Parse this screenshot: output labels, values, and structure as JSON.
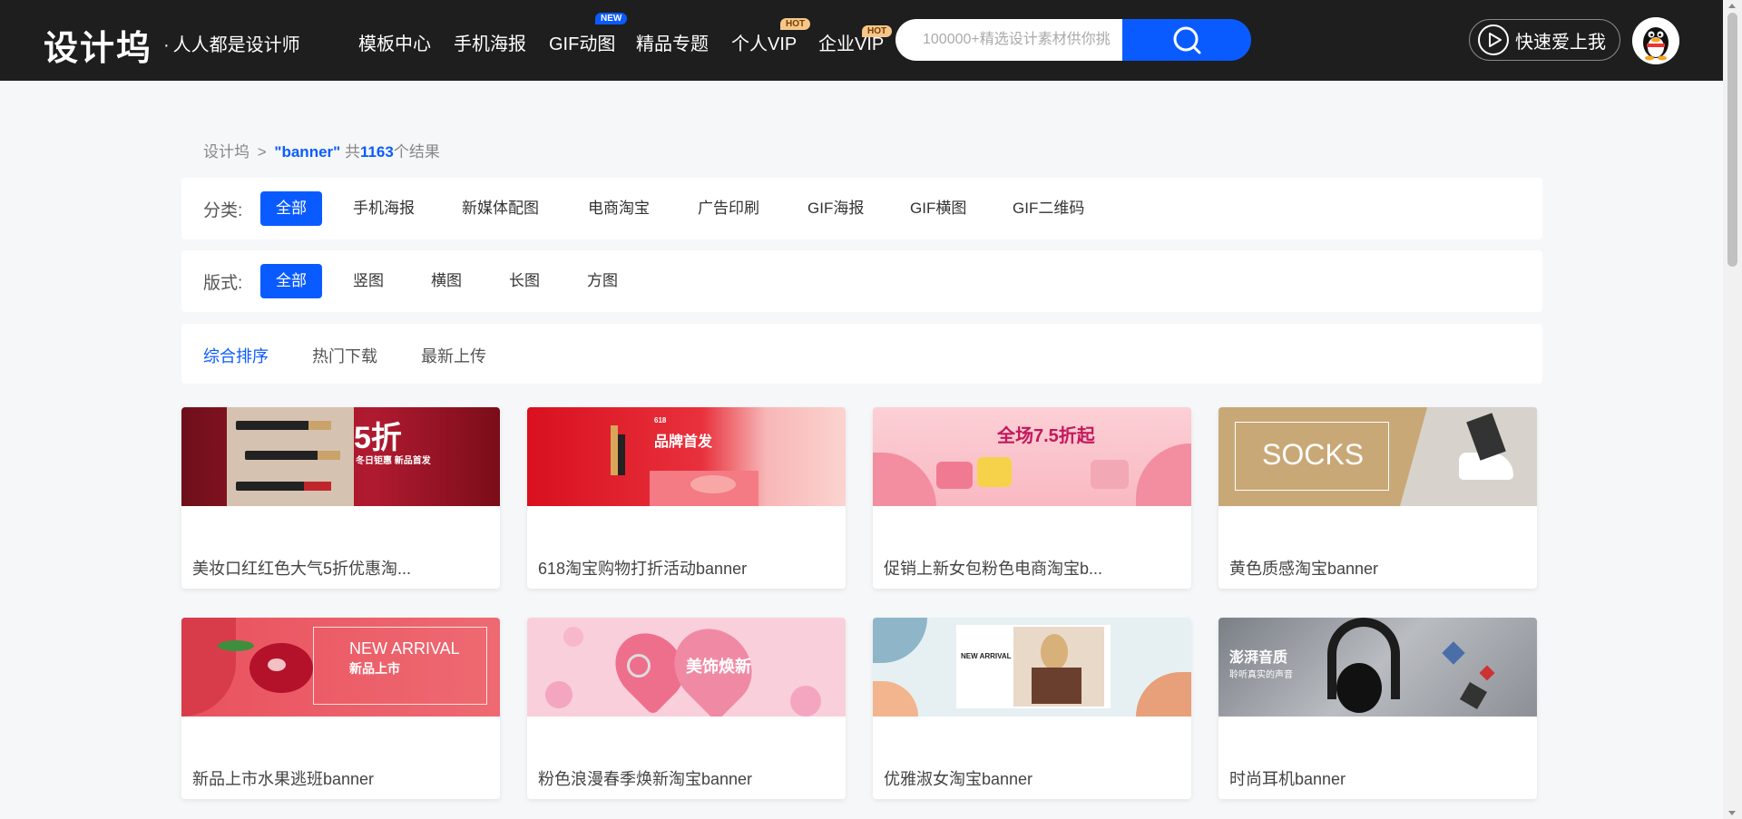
{
  "header": {
    "logo": "设计坞",
    "slogan": "人人都是设计师",
    "nav": [
      {
        "label": "模板中心",
        "badge": ""
      },
      {
        "label": "手机海报",
        "badge": ""
      },
      {
        "label": "GIF动图",
        "badge": "NEW"
      },
      {
        "label": "精品专题",
        "badge": ""
      },
      {
        "label": "个人VIP",
        "badge": "HOT"
      },
      {
        "label": "企业VIP",
        "badge": "HOT"
      }
    ],
    "search_placeholder": "100000+精选设计素材供你挑",
    "quick_label": "快速爱上我"
  },
  "breadcrumb": {
    "home": "设计坞",
    "separator": ">",
    "keyword": "\"banner\"",
    "prefix": "共",
    "count": "1163",
    "suffix": "个结果"
  },
  "filters": {
    "category_label": "分类:",
    "categories": [
      "全部",
      "手机海报",
      "新媒体配图",
      "电商淘宝",
      "广告印刷",
      "GIF海报",
      "GIF横图",
      "GIF二维码"
    ],
    "layout_label": "版式:",
    "layouts": [
      "全部",
      "竖图",
      "横图",
      "长图",
      "方图"
    ]
  },
  "sort": [
    "综合排序",
    "热门下载",
    "最新上传"
  ],
  "cards": [
    {
      "title": "美妆口红红色大气5折优惠淘...",
      "thumb_text": "5折",
      "thumb_sub": "冬日钜惠 新品首发"
    },
    {
      "title": "618淘宝购物打折活动banner",
      "thumb_text": "品牌首发",
      "thumb_sub": "618"
    },
    {
      "title": "促销上新女包粉色电商淘宝b...",
      "thumb_text": "全场7.5折起",
      "thumb_sub": ""
    },
    {
      "title": "黄色质感淘宝banner",
      "thumb_text": "SOCKS",
      "thumb_sub": ""
    },
    {
      "title": "新品上市水果逃班banner",
      "thumb_text": "NEW ARRIVAL",
      "thumb_sub": "新品上市"
    },
    {
      "title": "粉色浪漫春季焕新淘宝banner",
      "thumb_text": "美饰焕新",
      "thumb_sub": ""
    },
    {
      "title": "优雅淑女淘宝banner",
      "thumb_text": "NEW ARRIVAL",
      "thumb_sub": ""
    },
    {
      "title": "时尚耳机banner",
      "thumb_text": "澎湃音质",
      "thumb_sub": "聆听真实的声音"
    }
  ],
  "colors": {
    "accent": "#0a5bff",
    "header_bg": "#1e1e1e",
    "page_bg": "#f6f7f9"
  }
}
